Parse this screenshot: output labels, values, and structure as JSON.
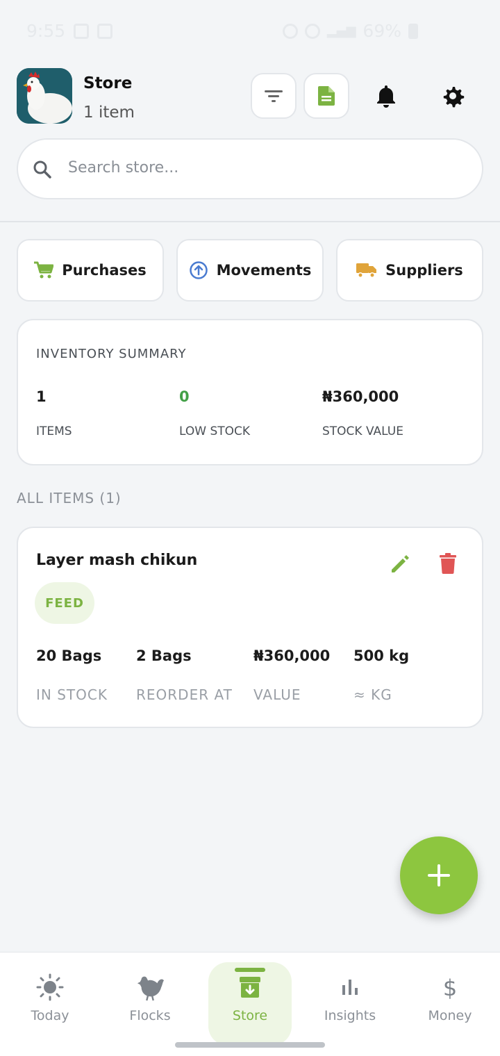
{
  "status_bar": {
    "time": "9:55",
    "battery": "69%"
  },
  "header": {
    "title": "Store",
    "subtitle": "1 item"
  },
  "search": {
    "placeholder": "Search store..."
  },
  "quick_actions": {
    "purchases": "Purchases",
    "movements": "Movements",
    "suppliers": "Suppliers"
  },
  "summary": {
    "caption": "INVENTORY SUMMARY",
    "items_value": "1",
    "items_label": "ITEMS",
    "low_stock_value": "0",
    "low_stock_label": "LOW STOCK",
    "stock_value_value": "₦360,000",
    "stock_value_label": "STOCK VALUE"
  },
  "section_title": "ALL ITEMS (1)",
  "item": {
    "name": "Layer mash chikun",
    "tag": "FEED",
    "in_stock_value": "20 Bags",
    "in_stock_label": "IN STOCK",
    "reorder_value": "2 Bags",
    "reorder_label": "REORDER AT",
    "value_value": "₦360,000",
    "value_label": "VALUE",
    "kg_value": "500 kg",
    "kg_label": "≈ KG"
  },
  "nav": {
    "today": "Today",
    "flocks": "Flocks",
    "store": "Store",
    "insights": "Insights",
    "money": "Money"
  },
  "colors": {
    "accent": "#8dc63f",
    "accent_text": "#7cb342",
    "delete": "#e05555",
    "low_stock": "#43a047"
  }
}
